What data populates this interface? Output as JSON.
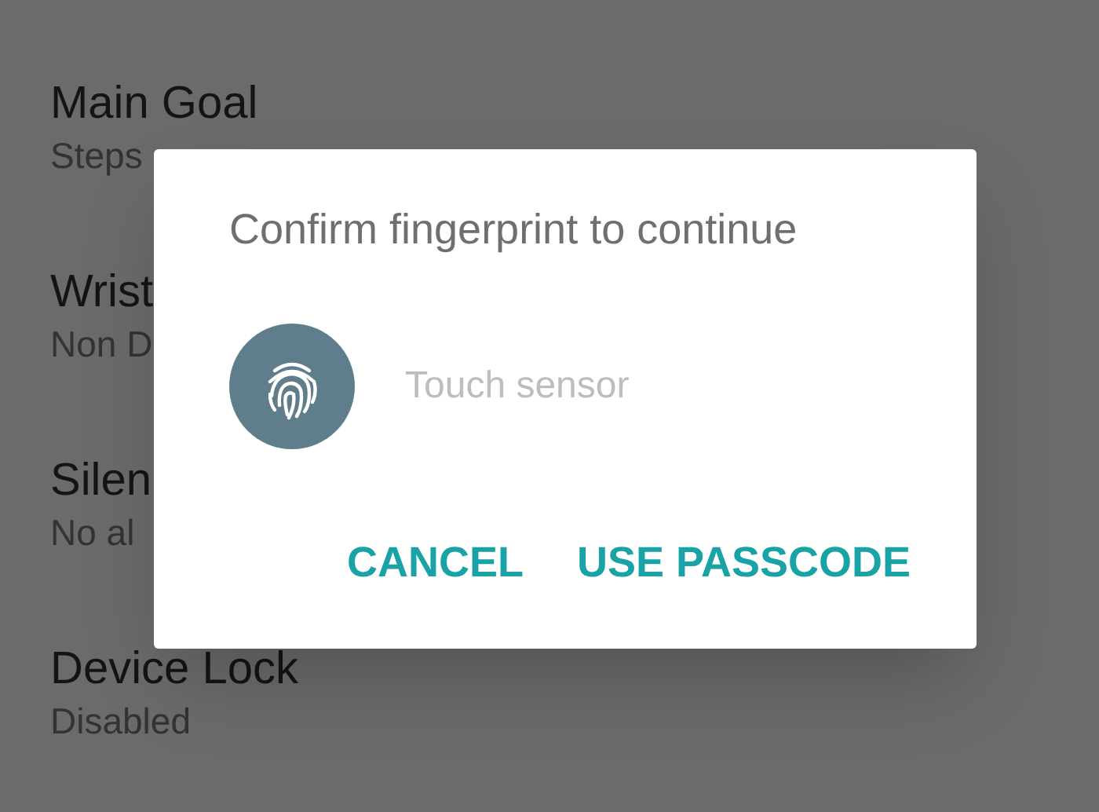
{
  "settings": [
    {
      "title": "Main Goal",
      "value": "Steps"
    },
    {
      "title": "Wrist",
      "value": "Non D"
    },
    {
      "title": "Silen",
      "value": "No al"
    },
    {
      "title": "Device Lock",
      "value": "Disabled"
    }
  ],
  "dialog": {
    "title": "Confirm fingerprint to continue",
    "hint": "Touch sensor",
    "buttons": [
      "CANCEL",
      "USE PASSCODE"
    ]
  }
}
